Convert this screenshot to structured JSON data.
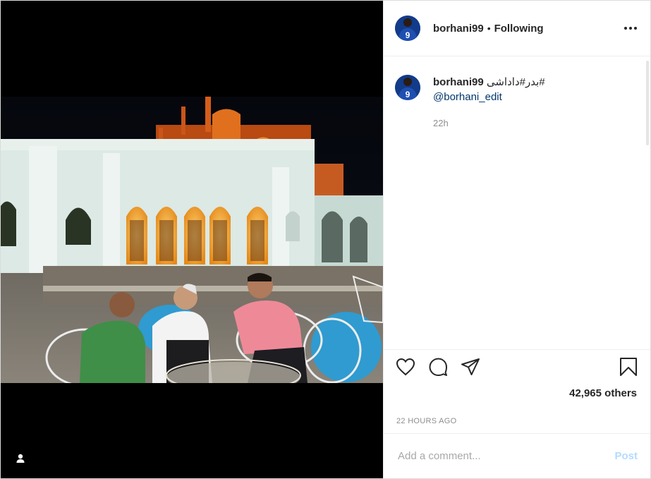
{
  "header": {
    "username": "borhani99",
    "separator": "•",
    "follow_state": "Following"
  },
  "caption": {
    "username": "borhani99",
    "text": "#بدر#داداشی",
    "mention": "@borhani_edit",
    "time": "22h"
  },
  "avatar": {
    "jersey_number": "9"
  },
  "likes": {
    "text": "42,965 others"
  },
  "timestamp": "22 HOURS AGO",
  "comment_box": {
    "placeholder": "Add a comment...",
    "post_label": "Post"
  },
  "icons": {
    "more": "more-options-icon",
    "like": "heart-icon",
    "comment": "comment-bubble-icon",
    "share": "paper-plane-icon",
    "save": "bookmark-icon",
    "tagged": "user-tag-icon"
  },
  "colors": {
    "text": "#262626",
    "muted": "#8e8e8e",
    "link": "#00376b",
    "post_disabled": "#b3dbff",
    "border": "#dbdbdb"
  }
}
